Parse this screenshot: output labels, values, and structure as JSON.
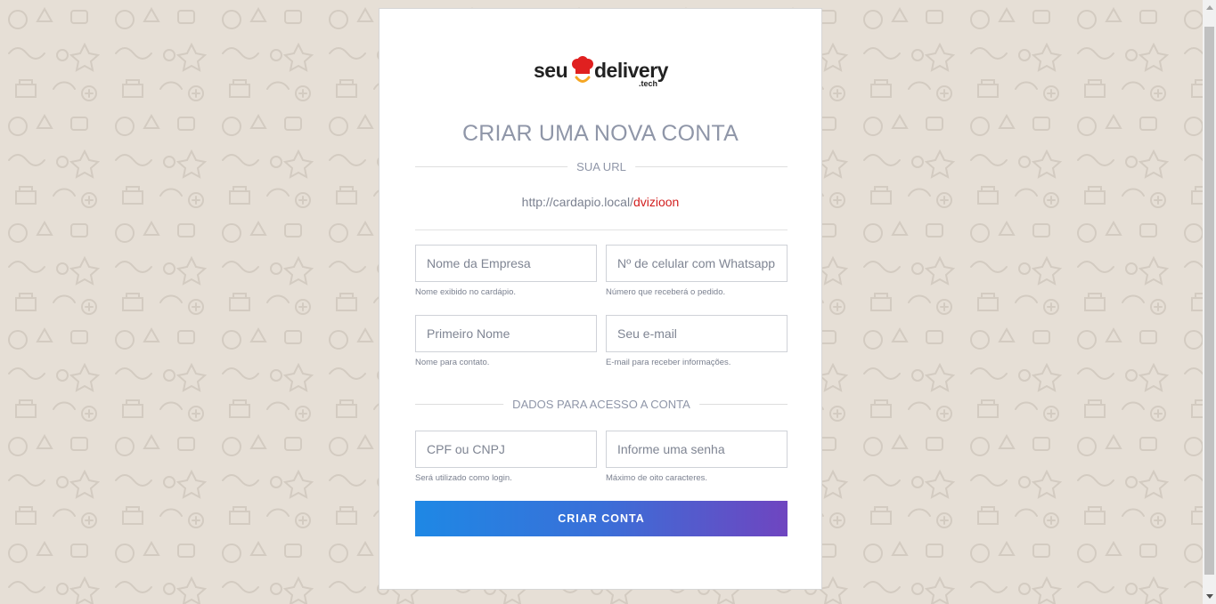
{
  "logo": {
    "word1": "seu",
    "word2": "delivery",
    "suffix": ".tech",
    "alt": "seu delivery .tech"
  },
  "heading": "CRIAR UMA NOVA CONTA",
  "url_section": {
    "label": "SUA URL",
    "base": "http://cardapio.local/",
    "slug": "dvizioon"
  },
  "fields": {
    "company": {
      "placeholder": "Nome da Empresa",
      "hint": "Nome exibido no cardápio."
    },
    "phone": {
      "placeholder": "Nº de celular com Whatsapp",
      "hint": "Número que receberá o pedido."
    },
    "first_name": {
      "placeholder": "Primeiro Nome",
      "hint": "Nome para contato."
    },
    "email": {
      "placeholder": "Seu e-mail",
      "hint": "E-mail para receber informações."
    },
    "cpf": {
      "placeholder": "CPF ou CNPJ",
      "hint": "Será utilizado como login."
    },
    "password": {
      "placeholder": "Informe uma senha",
      "hint": "Máximo de oito caracteres."
    }
  },
  "access_section": {
    "label": "DADOS PARA ACESSO A CONTA"
  },
  "submit_label": "CRIAR CONTA",
  "colors": {
    "accent_start": "#1e88e5",
    "accent_end": "#6f45c0",
    "slug": "#d21f1f",
    "background": "#e6dfd6",
    "heading": "#8f96a8"
  }
}
